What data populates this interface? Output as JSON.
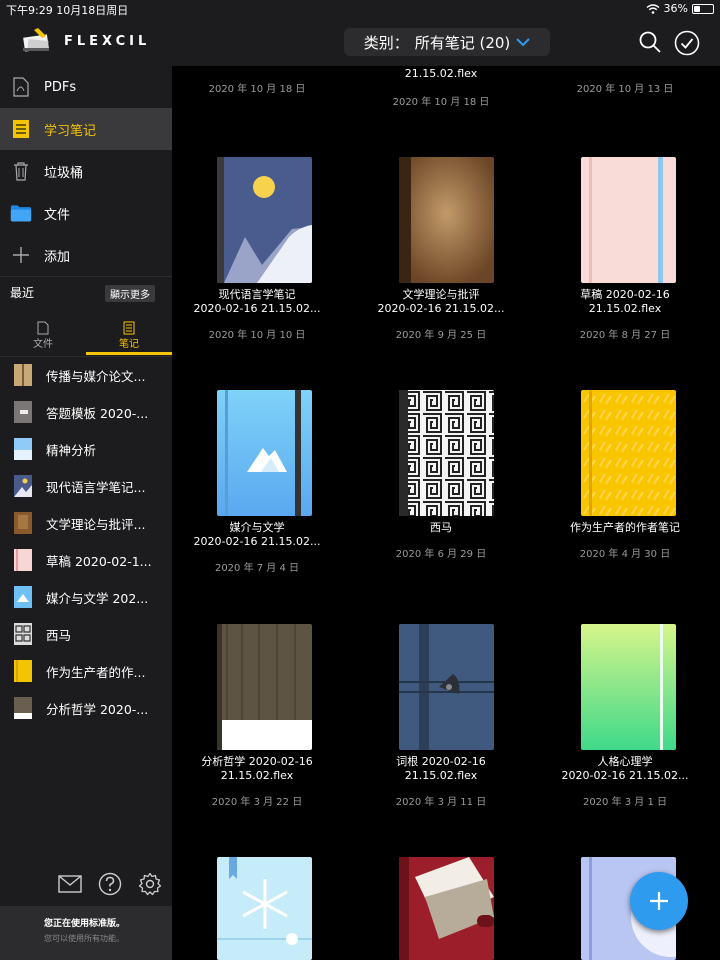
{
  "status": {
    "time": "下午9:29",
    "date": "10月18日周日",
    "battery": "36%",
    "battery_level": 0.36
  },
  "app": {
    "name": "FLEXCIL"
  },
  "sidebar": {
    "nav": [
      {
        "label": "PDFs",
        "icon": "pdf-icon"
      },
      {
        "label": "学习笔记",
        "icon": "notebook-icon"
      },
      {
        "label": "垃圾桶",
        "icon": "trash-icon"
      },
      {
        "label": "文件",
        "icon": "folder-icon"
      },
      {
        "label": "添加",
        "icon": "plus-icon"
      }
    ],
    "recent_title": "最近",
    "show_more": "顯示更多",
    "tabs": [
      {
        "label": "文件"
      },
      {
        "label": "笔记"
      }
    ],
    "recent": [
      {
        "label": "传播与媒介论文..."
      },
      {
        "label": "答题模板 2020-..."
      },
      {
        "label": "精神分析"
      },
      {
        "label": "现代语言学笔记..."
      },
      {
        "label": "文学理论与批评..."
      },
      {
        "label": "草稿 2020-02-1..."
      },
      {
        "label": "媒介与文学 202..."
      },
      {
        "label": "西马"
      },
      {
        "label": "作为生产者的作..."
      },
      {
        "label": "分析哲学 2020-..."
      }
    ],
    "footer": {
      "line1": "您正在使用标准版。",
      "line2": "您可以使用所有功能。"
    }
  },
  "topbar": {
    "category_label": "类别：",
    "category_value": "所有笔记 (20)"
  },
  "notes": [
    {
      "title": "",
      "date": "2020 年 10 月 18 日"
    },
    {
      "title": "21.15.02.flex",
      "date": "2020 年 10 月 18 日"
    },
    {
      "title": "",
      "date": "2020 年 10 月 13 日"
    },
    {
      "title": "现代语言学笔记\n2020-02-16 21.15.02...",
      "date": "2020 年 10 月 10 日"
    },
    {
      "title": "文学理论与批评\n2020-02-16 21.15.02...",
      "date": "2020 年 9 月 25 日"
    },
    {
      "title": "草稿 2020-02-16\n21.15.02.flex",
      "date": "2020 年 8 月 27 日"
    },
    {
      "title": "媒介与文学\n2020-02-16 21.15.02...",
      "date": "2020 年 7 月 4 日"
    },
    {
      "title": "西马",
      "date": "2020 年 6 月 29 日"
    },
    {
      "title": "作为生产者的作者笔记",
      "date": "2020 年 4 月 30 日"
    },
    {
      "title": "分析哲学 2020-02-16\n21.15.02.flex",
      "date": "2020 年 3 月 22 日"
    },
    {
      "title": "词根 2020-02-16\n21.15.02.flex",
      "date": "2020 年 3 月 11 日"
    },
    {
      "title": "人格心理学\n2020-02-16 21.15.02...",
      "date": "2020 年 3 月 1 日"
    }
  ]
}
